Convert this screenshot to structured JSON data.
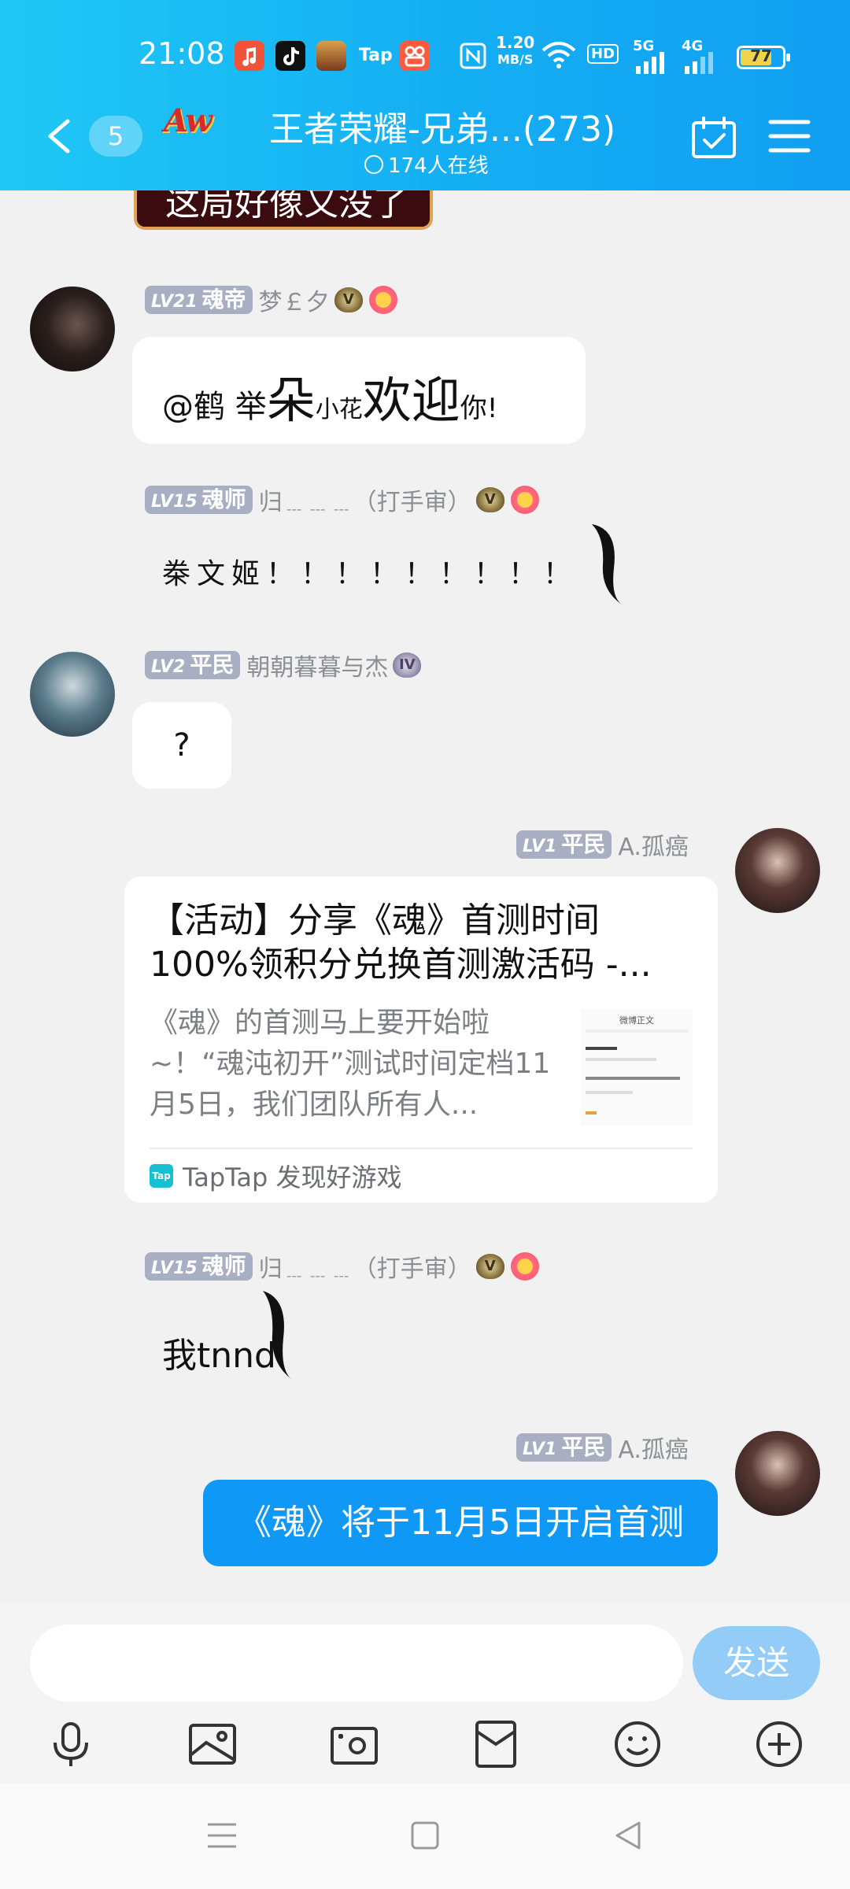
{
  "status_bar": {
    "time": "21:08",
    "network_speed_value": "1.20",
    "network_speed_unit": "MB/S",
    "hd_label": "HD",
    "signal_5g": "5G",
    "signal_4g": "4G",
    "tap_app_label": "Tap",
    "battery": "77"
  },
  "header": {
    "unread_count": "5",
    "logo_text": "Aw",
    "group_name": "王者荣耀-兄弟...(273)",
    "online_text": "174人在线"
  },
  "chat": {
    "top_sticker_text": "这局好像又没了",
    "messages": [
      {
        "level": "LV21",
        "rank": "魂帝",
        "name": "梦￡夕",
        "vbadge": "V",
        "text_parts": [
          "@鹤 举",
          "朵",
          "小花",
          "欢迎",
          "你!"
        ]
      },
      {
        "level": "LV15",
        "rank": "魂师",
        "name": "归﹍﹍﹍（打手审）",
        "vbadge": "V",
        "text": "桊文姬！！！！！！！！！"
      },
      {
        "level": "LV2",
        "rank": "平民",
        "name": "朝朝暮暮与杰",
        "vbadge": "IV",
        "text": "?"
      },
      {
        "level": "LV1",
        "rank": "平民",
        "name": "A.孤癌",
        "card": {
          "title": "【活动】分享《魂》首测时间100%领积分兑换首测激活码 -...",
          "description": "《魂》的首测马上要开始啦~！“魂沌初开”测试时间定档11月5日，我们团队所有人...",
          "thumb_title": "微博正文",
          "source_icon": "Tap",
          "source": "TapTap 发现好游戏"
        }
      },
      {
        "level": "LV15",
        "rank": "魂师",
        "name": "归﹍﹍﹍（打手审）",
        "vbadge": "V",
        "text": "我tnnd"
      },
      {
        "level": "LV1",
        "rank": "平民",
        "name": "A.孤癌",
        "text": "《魂》将于11月5日开启首测"
      }
    ]
  },
  "input": {
    "placeholder": "",
    "send_label": "发送"
  },
  "toolbar": {
    "icons": [
      "microphone-icon",
      "image-icon",
      "camera-icon",
      "red-packet-icon",
      "emoji-icon",
      "plus-icon"
    ]
  },
  "colors": {
    "header_start": "#1fc8f5",
    "header_end": "#119ff2",
    "my_bubble": "#0f98f5",
    "send_button": "#93cdf7",
    "level_badge": "#a9afc3"
  }
}
